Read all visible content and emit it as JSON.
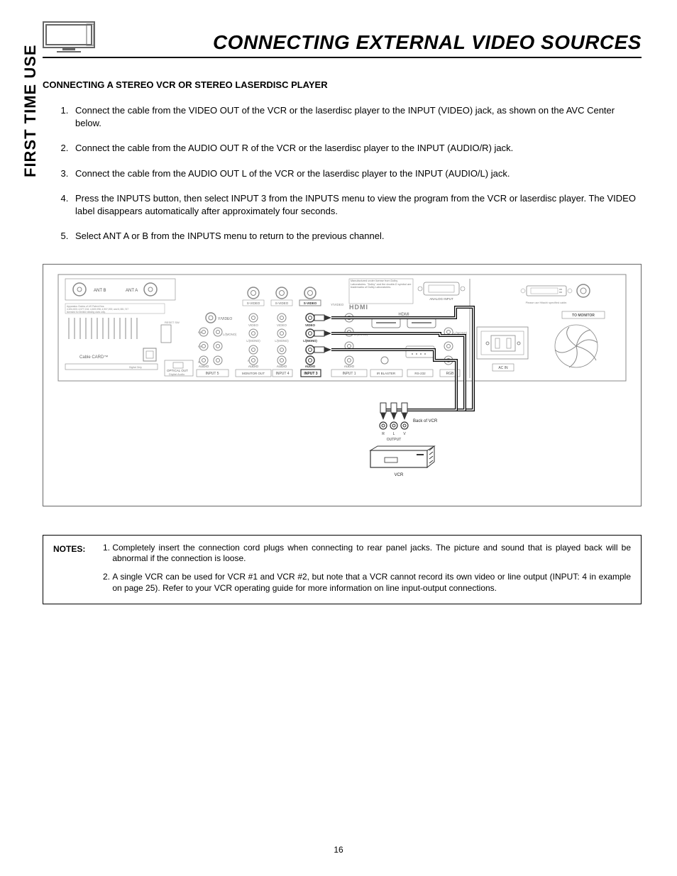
{
  "header": {
    "title": "CONNECTING EXTERNAL VIDEO SOURCES",
    "sideLabel": "FIRST TIME USE"
  },
  "section": {
    "heading": "CONNECTING A STEREO VCR OR STEREO LASERDISC PLAYER",
    "steps": [
      "Connect the cable from the VIDEO OUT of the VCR or the laserdisc player to the INPUT (VIDEO) jack, as shown on the AVC Center below.",
      "Connect the cable from the AUDIO OUT R of the VCR or the laserdisc player to the INPUT (AUDIO/R) jack.",
      "Connect the cable from the AUDIO OUT L of the VCR or the laserdisc player to the INPUT (AUDIO/L) jack.",
      "Press the INPUTS button, then select INPUT 3 from the INPUTS menu to view the program from the VCR or laserdisc player.  The VIDEO label disappears automatically after approximately four  seconds.",
      "Select ANT A or B from the INPUTS menu to return to the previous channel."
    ]
  },
  "diagram": {
    "labels": {
      "antB": "ANT B",
      "antA": "ANT A",
      "svideo": "S-VIDEO",
      "yvideo": "Y/VIDEO",
      "video": "VIDEO",
      "lmono": "L/(MONO)",
      "audio": "AUDIO",
      "hdmiBrand": "HDMI",
      "hdmi": "HDMI",
      "cableCard": "Cable CARD™",
      "opticalOut": "OPTICAL OUT",
      "digitalAudio": "Digital Audio",
      "input5": "INPUT 5",
      "monitorOut": "MONITOR OUT",
      "input4": "INPUT 4",
      "input3": "INPUT 3",
      "input1": "INPUT 1",
      "irBlaster": "IR BLASTER",
      "rs232": "RS-232",
      "rgb": "RGB",
      "analogInput": "ANALOG INPUT",
      "toMonitor": "TO MONITOR",
      "acIn": "AC IN",
      "dolby": "Manufactured under license from Dolby Laboratories. \"Dolby\" and the double-D symbol are trademarks of Dolby Laboratories.",
      "hitachiCable": "Please use Hitachi specified cable.",
      "backOfVcr": "Back of VCR",
      "vcrR": "R",
      "vcrL": "L",
      "vcrV": "V",
      "output": "OUTPUT",
      "vcr": "VCR"
    }
  },
  "notes": {
    "label": "NOTES:",
    "items": [
      "Completely insert the connection cord plugs when connecting to rear panel jacks.  The picture and sound that is played back will be abnormal if the connection is loose.",
      "A single VCR can be used for VCR #1 and VCR #2, but note that a VCR cannot record its own video or line output (INPUT: 4 in example on page 25).  Refer to your VCR operating guide for more information on line input-output connections."
    ]
  },
  "pageNumber": "16"
}
